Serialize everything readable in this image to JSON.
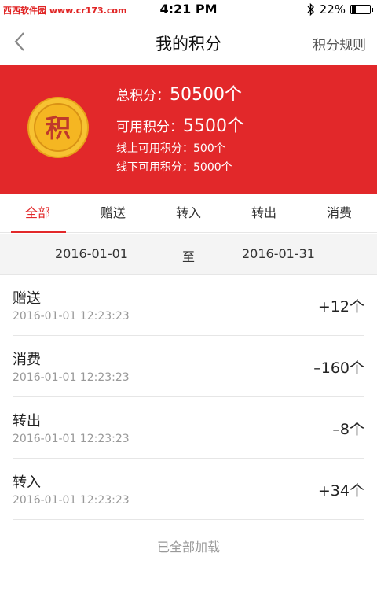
{
  "status": {
    "carrier": "西西软件园 www.cr173.com",
    "time": "4:21 PM",
    "battery": "22%",
    "battery_level": 0.22
  },
  "nav": {
    "title": "我的积分",
    "rules": "积分规则"
  },
  "banner": {
    "coin_char": "积",
    "total_label": "总积分：",
    "total_value": "50500个",
    "available_label": "可用积分：",
    "available_value": "5500个",
    "online": "线上可用积分：500个",
    "offline": "线下可用积分：5000个"
  },
  "tabs": [
    "全部",
    "赠送",
    "转入",
    "转出",
    "消费"
  ],
  "date_range": {
    "start": "2016-01-01",
    "separator": "至",
    "end": "2016-01-31"
  },
  "records": [
    {
      "type": "赠送",
      "time": "2016-01-01 12:23:23",
      "amount": "+12个"
    },
    {
      "type": "消费",
      "time": "2016-01-01 12:23:23",
      "amount": "–160个"
    },
    {
      "type": "转出",
      "time": "2016-01-01 12:23:23",
      "amount": "–8个"
    },
    {
      "type": "转入",
      "time": "2016-01-01 12:23:23",
      "amount": "+34个"
    }
  ],
  "footer": {
    "loaded_text": "已全部加载"
  },
  "colors": {
    "accent": "#e2282a",
    "coin": "#f5b622"
  }
}
